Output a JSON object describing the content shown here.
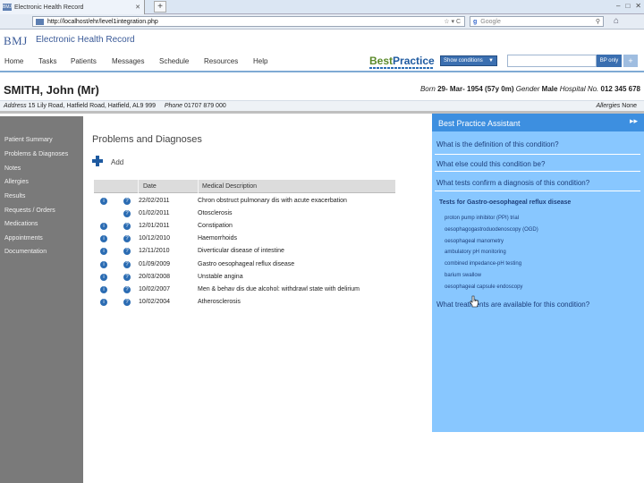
{
  "browser": {
    "tab_title": "Electronic Health Record",
    "tab_icon_text": "BMJ",
    "new_tab": "+",
    "url": "http://localhost/ehr/level1integration.php",
    "search_engine": "Google",
    "search_placeholder": "Google"
  },
  "app": {
    "brand": "BMJ",
    "title": "Electronic Health Record"
  },
  "menu": [
    "Home",
    "Tasks",
    "Patients",
    "Messages",
    "Schedule",
    "Resources",
    "Help"
  ],
  "best_practice": {
    "logo_a": "Best",
    "logo_b": "Practice",
    "show_conditions": "Show conditions",
    "bp_only": "BP only",
    "plus": "+"
  },
  "patient": {
    "name": "SMITH, John (Mr)",
    "born_label": "Born",
    "born": "29- Mar- 1954 (57y 0m)",
    "gender_label": "Gender",
    "gender": "Male",
    "hospital_label": "Hospital No.",
    "hospital_no": "012 345 678",
    "address_label": "Address",
    "address": "15 Lily Road, Hatfield Road, Hatfield, AL9 999",
    "phone_label": "Phone",
    "phone": "01707 879 000",
    "allergies_label": "Allergies",
    "allergies": "None"
  },
  "sidebar": [
    "Patient Summary",
    "Problems & Diagnoses",
    "Notes",
    "Allergies",
    "Results",
    "Requests / Orders",
    "Medications",
    "Appointments",
    "Documentation"
  ],
  "main": {
    "title": "Problems and Diagnoses",
    "add_label": "Add",
    "col_date": "Date",
    "col_desc": "Medical Description",
    "rows": [
      {
        "date": "22/02/2011",
        "desc": "Chron obstruct pulmonary dis with acute exacerbation",
        "icon1": true
      },
      {
        "date": "01/02/2011",
        "desc": "Otosclerosis",
        "icon1": false
      },
      {
        "date": "12/01/2011",
        "desc": "Constipation",
        "icon1": true
      },
      {
        "date": "10/12/2010",
        "desc": "Haemorrhoids",
        "icon1": true
      },
      {
        "date": "12/11/2010",
        "desc": "Diverticular disease of intestine",
        "icon1": true
      },
      {
        "date": "01/09/2009",
        "desc": "Gastro oesophageal reflux disease",
        "icon1": true
      },
      {
        "date": "20/03/2008",
        "desc": "Unstable angina",
        "icon1": true
      },
      {
        "date": "10/02/2007",
        "desc": "Men & behav dis due alcohol: withdrawl state with delirium",
        "icon1": true
      },
      {
        "date": "10/02/2004",
        "desc": "Atherosclerosis",
        "icon1": true
      }
    ]
  },
  "assistant": {
    "title": "Best Practice Assistant",
    "collapse": "▸▸",
    "questions": [
      "What is the definition of this condition?",
      "What else could this condition be?",
      "What tests confirm a diagnosis of this condition?"
    ],
    "tests_heading": "Tests for Gastro-oesophageal reflux disease",
    "tests": [
      "proton pump inhibitor (PPI) trial",
      "oesophagogastroduodenoscopy (OGD)",
      "oesophageal manometry",
      "ambulatory pH monitoring",
      "combined impedance-pH testing",
      "barium swallow",
      "oesophageal capsule endoscopy"
    ],
    "last_question": "What treatments are available for this condition?"
  },
  "colors": {
    "sidebar": "#7a7a7a",
    "assistant_bg": "#88c7ff",
    "assistant_head": "#3d8fe0",
    "brand": "#3a5a98"
  }
}
